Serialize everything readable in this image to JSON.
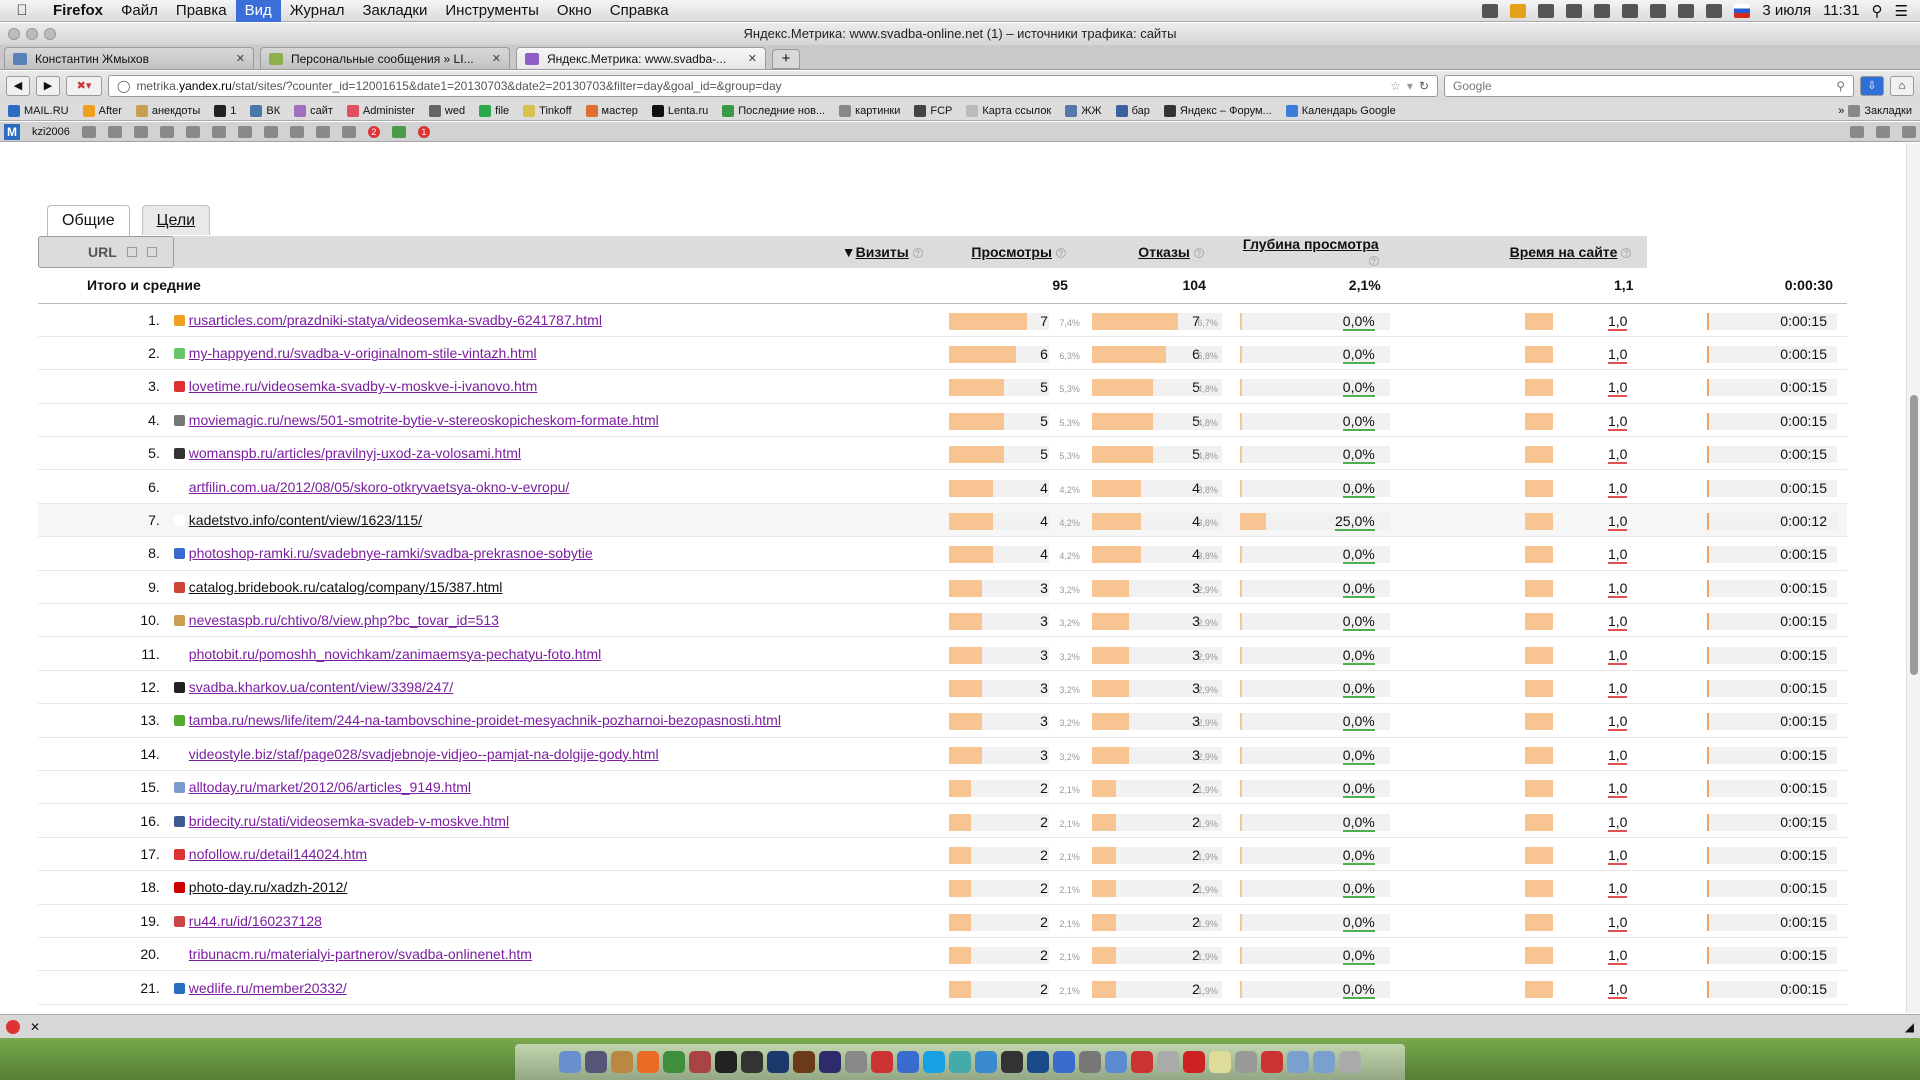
{
  "menubar": {
    "app": "Firefox",
    "items": [
      "Файл",
      "Правка",
      "Вид",
      "Журнал",
      "Закладки",
      "Инструменты",
      "Окно",
      "Справка"
    ],
    "active": "Вид",
    "date": "3 июля",
    "time": "11:31"
  },
  "window": {
    "title": "Яндекс.Метрика: www.svadba-online.net (1) – источники трафика: сайты"
  },
  "tabs": [
    {
      "label": "Константин Жмыхов"
    },
    {
      "label": "Персональные сообщения » LI..."
    },
    {
      "label": "Яндекс.Метрика: www.svadba-..."
    }
  ],
  "address": {
    "prefix": "metrika.",
    "host": "yandex.ru",
    "path": "/stat/sites/?counter_id=12001615&date1=20130703&date2=20130703&filter=day&goal_id=&group=day"
  },
  "search": {
    "placeholder": "Google",
    "engine_label": "Google"
  },
  "bookmarks": [
    "MAIL.RU",
    "After",
    "анекдоты",
    "1",
    "ВК",
    "сайт",
    "Administer",
    "wed",
    "file",
    "Tinkoff",
    "мастер",
    "Lenta.ru",
    "Последние нов...",
    "картинки",
    "FCP",
    "Карта ссылок",
    "ЖЖ",
    "бар",
    "Яндекс – Форум...",
    "Календарь Google"
  ],
  "bookmarks_menu": "Закладки",
  "addon": {
    "user": "kzi2006",
    "badge1": "2",
    "badge2": "1"
  },
  "report": {
    "tabs": [
      "Общие",
      "Цели"
    ],
    "headers": {
      "url": "URL",
      "visits": "Визиты",
      "views": "Просмотры",
      "bounce": "Отказы",
      "depth": "Глубина просмотра",
      "time": "Время на сайте"
    },
    "totals": {
      "label": "Итого и средние",
      "visits": "95",
      "views": "104",
      "bounce": "2,1%",
      "depth": "1,1",
      "time": "0:00:30"
    },
    "rows": [
      {
        "n": "1.",
        "url": "rusarticles.com/prazdniki-statya/videosemka-svadby-6241787.html",
        "visits": "7",
        "vp": "7,4%",
        "views": "7",
        "pp": "6,7%",
        "bounce": "0,0%",
        "depth": "1,0",
        "time": "0:00:15"
      },
      {
        "n": "2.",
        "url": "my-happyend.ru/svadba-v-originalnom-stile-vintazh.html",
        "visits": "6",
        "vp": "6,3%",
        "views": "6",
        "pp": "5,8%",
        "bounce": "0,0%",
        "depth": "1,0",
        "time": "0:00:15"
      },
      {
        "n": "3.",
        "url": "lovetime.ru/videosemka-svadby-v-moskve-i-ivanovo.htm",
        "visits": "5",
        "vp": "5,3%",
        "views": "5",
        "pp": "4,8%",
        "bounce": "0,0%",
        "depth": "1,0",
        "time": "0:00:15"
      },
      {
        "n": "4.",
        "url": "moviemagic.ru/news/501-smotrite-bytie-v-stereoskopicheskom-formate.html",
        "visits": "5",
        "vp": "5,3%",
        "views": "5",
        "pp": "4,8%",
        "bounce": "0,0%",
        "depth": "1,0",
        "time": "0:00:15"
      },
      {
        "n": "5.",
        "url": "womanspb.ru/articles/pravilnyj-uxod-za-volosami.html",
        "visits": "5",
        "vp": "5,3%",
        "views": "5",
        "pp": "4,8%",
        "bounce": "0,0%",
        "depth": "1,0",
        "time": "0:00:15"
      },
      {
        "n": "6.",
        "url": "artfilin.com.ua/2012/08/05/skoro-otkryvaetsya-okno-v-evropu/",
        "visits": "4",
        "vp": "4,2%",
        "views": "4",
        "pp": "3,8%",
        "bounce": "0,0%",
        "depth": "1,0",
        "time": "0:00:15"
      },
      {
        "n": "7.",
        "url": "kadetstvo.info/content/view/1623/115/",
        "visits": "4",
        "vp": "4,2%",
        "views": "4",
        "pp": "3,8%",
        "bounce": "25,0%",
        "depth": "1,0",
        "time": "0:00:12"
      },
      {
        "n": "8.",
        "url": "photoshop-ramki.ru/svadebnye-ramki/svadba-prekrasnoe-sobytie",
        "visits": "4",
        "vp": "4,2%",
        "views": "4",
        "pp": "3,8%",
        "bounce": "0,0%",
        "depth": "1,0",
        "time": "0:00:15"
      },
      {
        "n": "9.",
        "url": "catalog.bridebook.ru/catalog/company/15/387.html",
        "visits": "3",
        "vp": "3,2%",
        "views": "3",
        "pp": "2,9%",
        "bounce": "0,0%",
        "depth": "1,0",
        "time": "0:00:15"
      },
      {
        "n": "10.",
        "url": "nevestaspb.ru/chtivo/8/view.php?bc_tovar_id=513",
        "visits": "3",
        "vp": "3,2%",
        "views": "3",
        "pp": "2,9%",
        "bounce": "0,0%",
        "depth": "1,0",
        "time": "0:00:15"
      },
      {
        "n": "11.",
        "url": "photobit.ru/pomoshh_novichkam/zanimaemsya-pechatyu-foto.html",
        "visits": "3",
        "vp": "3,2%",
        "views": "3",
        "pp": "2,9%",
        "bounce": "0,0%",
        "depth": "1,0",
        "time": "0:00:15"
      },
      {
        "n": "12.",
        "url": "svadba.kharkov.ua/content/view/3398/247/",
        "visits": "3",
        "vp": "3,2%",
        "views": "3",
        "pp": "2,9%",
        "bounce": "0,0%",
        "depth": "1,0",
        "time": "0:00:15"
      },
      {
        "n": "13.",
        "url": "tamba.ru/news/life/item/244-na-tambovschine-proidet-mesyachnik-pozharnoi-bezopasnosti.html",
        "visits": "3",
        "vp": "3,2%",
        "views": "3",
        "pp": "2,9%",
        "bounce": "0,0%",
        "depth": "1,0",
        "time": "0:00:15"
      },
      {
        "n": "14.",
        "url": "videostyle.biz/staf/page028/svadjebnoje-vidjeo--pamjat-na-dolgije-gody.html",
        "visits": "3",
        "vp": "3,2%",
        "views": "3",
        "pp": "2,9%",
        "bounce": "0,0%",
        "depth": "1,0",
        "time": "0:00:15"
      },
      {
        "n": "15.",
        "url": "alltoday.ru/market/2012/06/articles_9149.html",
        "visits": "2",
        "vp": "2,1%",
        "views": "2",
        "pp": "1,9%",
        "bounce": "0,0%",
        "depth": "1,0",
        "time": "0:00:15"
      },
      {
        "n": "16.",
        "url": "bridecity.ru/stati/videosemka-svadeb-v-moskve.html",
        "visits": "2",
        "vp": "2,1%",
        "views": "2",
        "pp": "1,9%",
        "bounce": "0,0%",
        "depth": "1,0",
        "time": "0:00:15"
      },
      {
        "n": "17.",
        "url": "nofollow.ru/detail144024.htm",
        "visits": "2",
        "vp": "2,1%",
        "views": "2",
        "pp": "1,9%",
        "bounce": "0,0%",
        "depth": "1,0",
        "time": "0:00:15"
      },
      {
        "n": "18.",
        "url": "photo-day.ru/xadzh-2012/",
        "visits": "2",
        "vp": "2,1%",
        "views": "2",
        "pp": "1,9%",
        "bounce": "0,0%",
        "depth": "1,0",
        "time": "0:00:15"
      },
      {
        "n": "19.",
        "url": "ru44.ru/id/160237128",
        "visits": "2",
        "vp": "2,1%",
        "views": "2",
        "pp": "1,9%",
        "bounce": "0,0%",
        "depth": "1,0",
        "time": "0:00:15"
      },
      {
        "n": "20.",
        "url": "tribunacm.ru/materialyi-partnerov/svadba-onlinenet.htm",
        "visits": "2",
        "vp": "2,1%",
        "views": "2",
        "pp": "1,9%",
        "bounce": "0,0%",
        "depth": "1,0",
        "time": "0:00:15"
      },
      {
        "n": "21.",
        "url": "wedlife.ru/member20332/",
        "visits": "2",
        "vp": "2,1%",
        "views": "2",
        "pp": "1,9%",
        "bounce": "0,0%",
        "depth": "1,0",
        "time": "0:00:15"
      }
    ]
  },
  "colors": {
    "bar": "#f8c592",
    "link": "#7b1f9e",
    "bounce_ok": "#4caf50",
    "depth_mark": "#e05050"
  }
}
